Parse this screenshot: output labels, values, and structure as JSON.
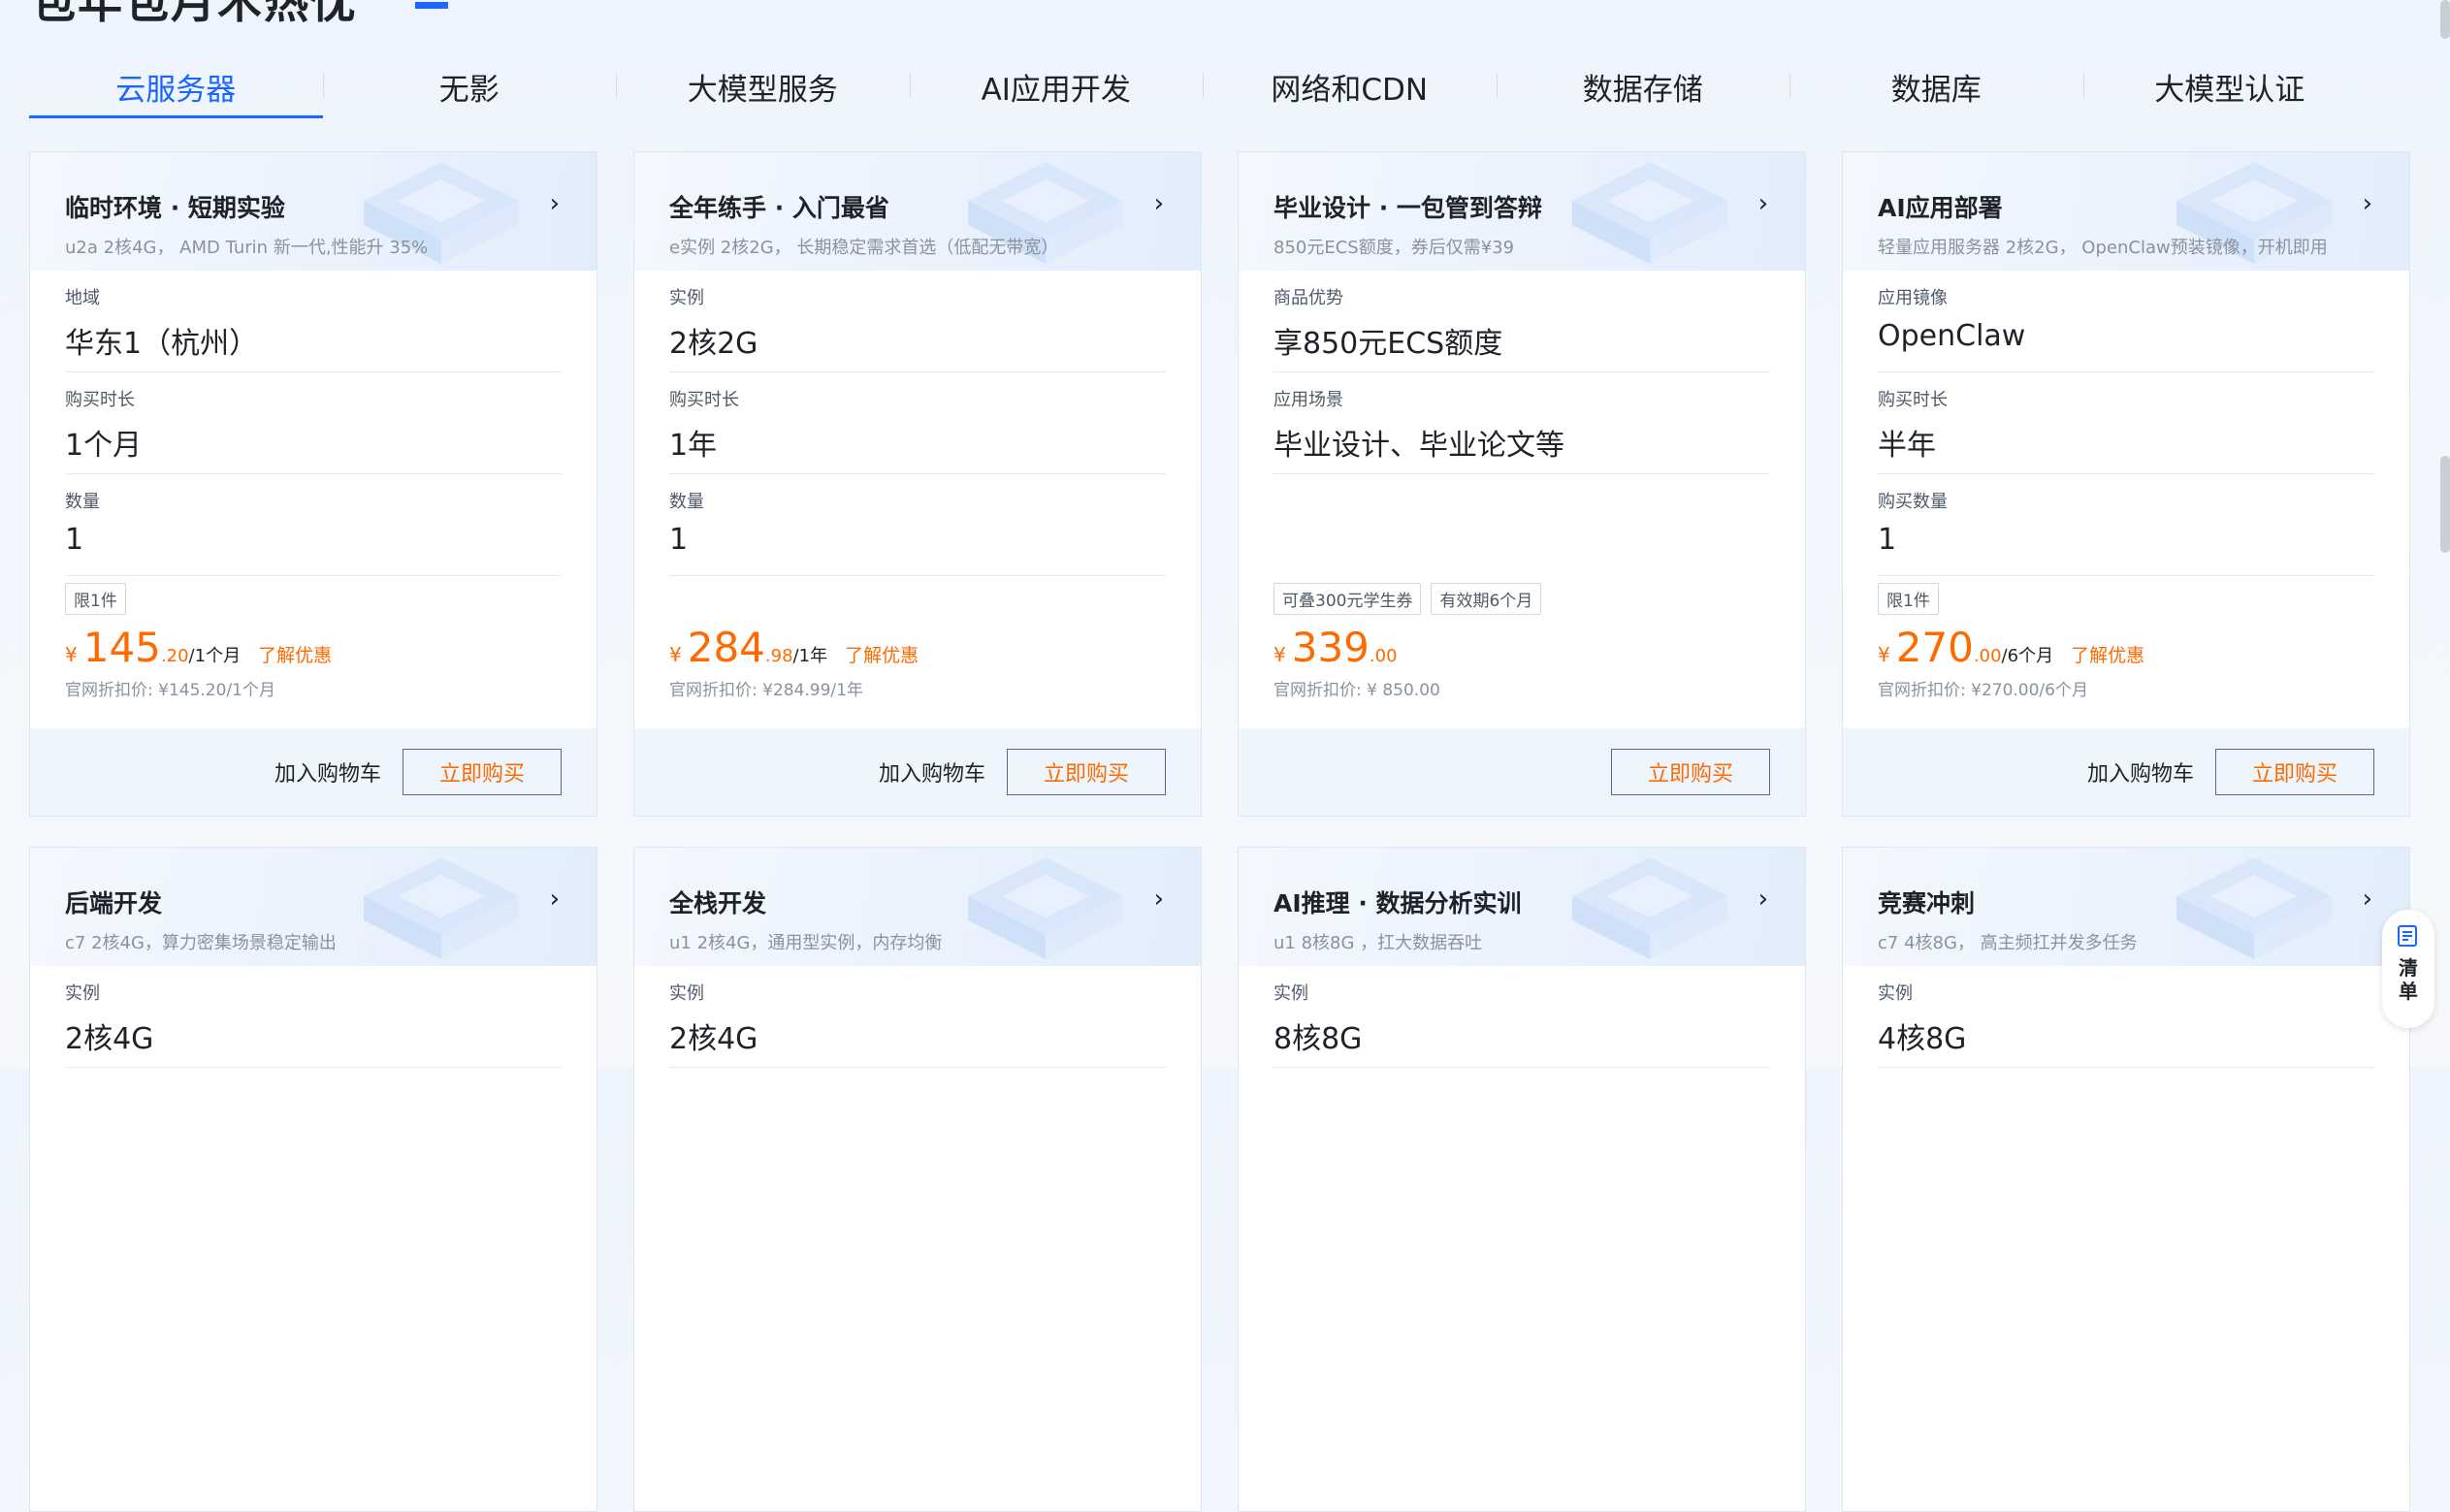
{
  "tabs": [
    "云服务器",
    "无影",
    "大模型服务",
    "AI应用开发",
    "网络和CDN",
    "数据存储",
    "数据库",
    "大模型认证"
  ],
  "heading": {
    "text": "包年包月术热忱"
  },
  "cards": [
    {
      "title": "临时环境 · 短期实验",
      "subtitle": "u2a 2核4G， AMD Turin 新一代,性能升 35%",
      "fields": [
        {
          "label": "地域",
          "value": "华东1（杭州）"
        },
        {
          "label": "购买时长",
          "value": "1个月"
        },
        {
          "label": "数量",
          "value": "1"
        }
      ],
      "badges": [
        "限1件"
      ],
      "price": {
        "currency": "¥",
        "int": "145",
        "dec": ".20",
        "unit": "/1个月",
        "link": "了解优惠"
      },
      "official": "官网折扣价: ¥145.20/1个月",
      "cart": "加入购物车",
      "buy": "立即购买"
    },
    {
      "title": "全年练手 · 入门最省",
      "subtitle": "e实例 2核2G， 长期稳定需求首选（低配无带宽）",
      "fields": [
        {
          "label": "实例",
          "value": "2核2G"
        },
        {
          "label": "购买时长",
          "value": "1年"
        },
        {
          "label": "数量",
          "value": "1"
        }
      ],
      "badges": [],
      "price": {
        "currency": "¥",
        "int": "284",
        "dec": ".98",
        "unit": "/1年",
        "link": "了解优惠"
      },
      "official": "官网折扣价: ¥284.99/1年",
      "cart": "加入购物车",
      "buy": "立即购买"
    },
    {
      "title": "毕业设计 · 一包管到答辩",
      "subtitle": "850元ECS额度，券后仅需¥39",
      "fields": [
        {
          "label": "商品优势",
          "value": "享850元ECS额度"
        },
        {
          "label": "应用场景",
          "value": "毕业设计、毕业论文等"
        }
      ],
      "badges": [
        "可叠300元学生券",
        "有效期6个月"
      ],
      "price": {
        "currency": "¥",
        "int": "339",
        "dec": ".00",
        "unit": "",
        "link": ""
      },
      "official": "官网折扣价: ¥ 850.00",
      "cart": "",
      "buy": "立即购买"
    },
    {
      "title": "AI应用部署",
      "subtitle": "轻量应用服务器 2核2G， OpenClaw预装镜像，开机即用",
      "fields": [
        {
          "label": "应用镜像",
          "value": "OpenClaw"
        },
        {
          "label": "购买时长",
          "value": "半年"
        },
        {
          "label": "购买数量",
          "value": "1"
        }
      ],
      "badges": [
        "限1件"
      ],
      "price": {
        "currency": "¥",
        "int": "270",
        "dec": ".00",
        "unit": "/6个月",
        "link": "了解优惠"
      },
      "official": "官网折扣价: ¥270.00/6个月",
      "cart": "加入购物车",
      "buy": "立即购买"
    },
    {
      "title": "后端开发",
      "subtitle": "c7 2核4G，算力密集场景稳定输出",
      "fields": [
        {
          "label": "实例",
          "value": "2核4G"
        }
      ]
    },
    {
      "title": "全栈开发",
      "subtitle": "u1 2核4G，通用型实例，内存均衡",
      "fields": [
        {
          "label": "实例",
          "value": "2核4G"
        }
      ]
    },
    {
      "title": "AI推理 · 数据分析实训",
      "subtitle": "u1 8核8G ，扛大数据吞吐",
      "fields": [
        {
          "label": "实例",
          "value": "8核8G"
        }
      ]
    },
    {
      "title": "竞赛冲刺",
      "subtitle": "c7 4核8G， 高主频扛并发多任务",
      "fields": [
        {
          "label": "实例",
          "value": "4核8G"
        }
      ]
    }
  ],
  "float_widget": {
    "label": "清单",
    "icon": "list-icon"
  },
  "colors": {
    "accent": "#1a66ff",
    "price": "#ff6a00"
  }
}
